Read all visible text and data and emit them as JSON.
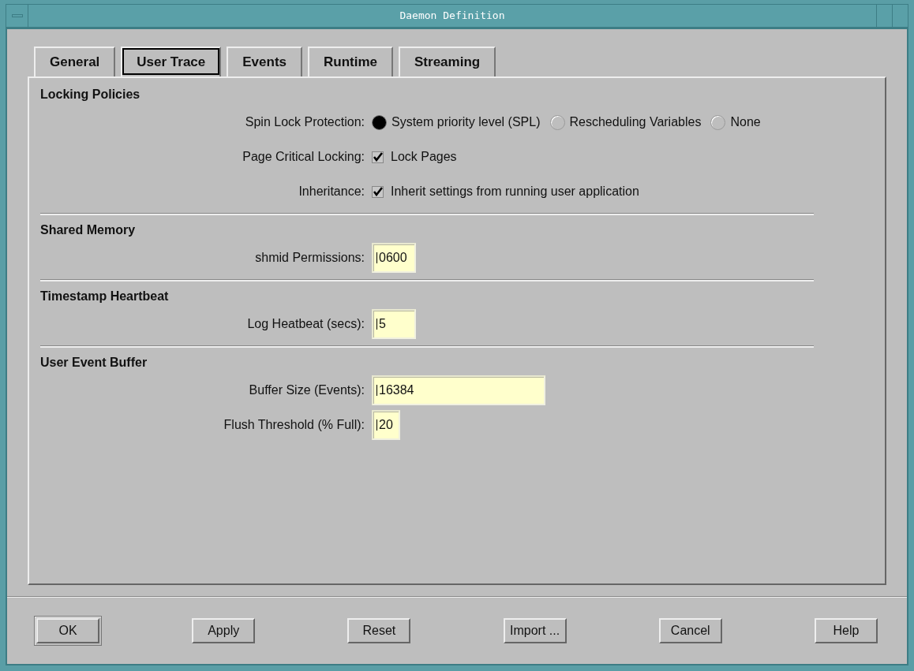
{
  "window": {
    "title": "Daemon Definition"
  },
  "tabs": [
    {
      "label": "General",
      "selected": false
    },
    {
      "label": "User Trace",
      "selected": true
    },
    {
      "label": "Events",
      "selected": false
    },
    {
      "label": "Runtime",
      "selected": false
    },
    {
      "label": "Streaming",
      "selected": false
    }
  ],
  "sections": [
    {
      "title": "Locking Policies",
      "rows": [
        {
          "kind": "radio",
          "label": "Spin Lock Protection:",
          "options": [
            {
              "label": "System priority level (SPL)",
              "selected": true
            },
            {
              "label": "Rescheduling  Variables",
              "selected": false
            },
            {
              "label": "None",
              "selected": false
            }
          ]
        },
        {
          "kind": "checkbox",
          "label": "Page Critical Locking:",
          "text": "Lock Pages",
          "checked": true
        },
        {
          "kind": "checkbox",
          "label": "Inheritance:",
          "text": "Inherit settings from running user application",
          "checked": true
        }
      ]
    },
    {
      "title": "Shared Memory",
      "rows": [
        {
          "kind": "field",
          "label": "shmid Permissions:",
          "value": "0600"
        }
      ]
    },
    {
      "title": "Timestamp Heartbeat",
      "rows": [
        {
          "kind": "field",
          "label": "Log Heatbeat (secs):",
          "value": "5"
        }
      ]
    },
    {
      "title": "User Event Buffer",
      "rows": [
        {
          "kind": "field",
          "label": "Buffer Size (Events):",
          "value": "16384"
        },
        {
          "kind": "field",
          "label": "Flush Threshold (% Full):",
          "value": "20"
        }
      ]
    }
  ],
  "buttons": [
    {
      "label": "OK",
      "default": true
    },
    {
      "label": "Apply",
      "default": false
    },
    {
      "label": "Reset",
      "default": false
    },
    {
      "label": "Import ...",
      "default": false
    },
    {
      "label": "Cancel",
      "default": false
    },
    {
      "label": "Help",
      "default": false
    }
  ]
}
